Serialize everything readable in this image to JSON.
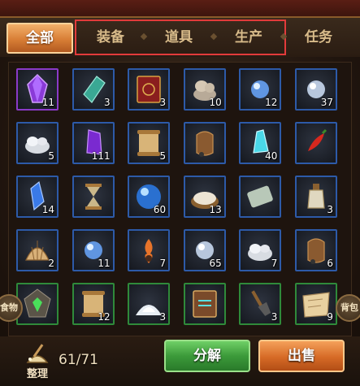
{
  "tabs": {
    "all": "全部",
    "items": [
      "装备",
      "道具",
      "生产",
      "任务"
    ]
  },
  "colors": {
    "tab_highlight_border": "#e23b3b",
    "slot_blue": "#2d5aa8",
    "slot_green": "#2f8a3a",
    "slot_purple": "#8a3ac8"
  },
  "inventory": [
    {
      "icon": "purple-gem-icon",
      "count": "11",
      "rarity": "purple"
    },
    {
      "icon": "green-crystal-icon",
      "count": "3",
      "rarity": "blue"
    },
    {
      "icon": "red-book-icon",
      "count": "3",
      "rarity": "blue"
    },
    {
      "icon": "stone-pile-icon",
      "count": "10",
      "rarity": "blue"
    },
    {
      "icon": "blue-orb-icon",
      "count": "12",
      "rarity": "blue"
    },
    {
      "icon": "white-orb-icon",
      "count": "37",
      "rarity": "blue"
    },
    {
      "icon": "silver-ore-icon",
      "count": "5",
      "rarity": "blue"
    },
    {
      "icon": "purple-crystal-icon",
      "count": "111",
      "rarity": "blue"
    },
    {
      "icon": "scroll-icon",
      "count": "5",
      "rarity": "blue"
    },
    {
      "icon": "leather-pouch-icon",
      "count": "",
      "rarity": "blue"
    },
    {
      "icon": "cyan-crystal-icon",
      "count": "40",
      "rarity": "blue"
    },
    {
      "icon": "red-pepper-icon",
      "count": "",
      "rarity": "blue"
    },
    {
      "icon": "blue-crystal-icon",
      "count": "14",
      "rarity": "blue"
    },
    {
      "icon": "hourglass-icon",
      "count": "",
      "rarity": "blue"
    },
    {
      "icon": "blue-sphere-icon",
      "count": "60",
      "rarity": "blue"
    },
    {
      "icon": "flour-bowl-icon",
      "count": "13",
      "rarity": "blue"
    },
    {
      "icon": "cloth-roll-icon",
      "count": "",
      "rarity": "blue"
    },
    {
      "icon": "potion-bottle-icon",
      "count": "3",
      "rarity": "blue"
    },
    {
      "icon": "shell-icon",
      "count": "2",
      "rarity": "blue"
    },
    {
      "icon": "blue-orb-icon",
      "count": "11",
      "rarity": "blue"
    },
    {
      "icon": "flame-ring-icon",
      "count": "7",
      "rarity": "blue"
    },
    {
      "icon": "white-orb-icon",
      "count": "65",
      "rarity": "blue"
    },
    {
      "icon": "silver-ore-icon",
      "count": "7",
      "rarity": "blue"
    },
    {
      "icon": "leather-pouch-icon",
      "count": "6",
      "rarity": "blue"
    },
    {
      "icon": "green-rune-icon",
      "count": "",
      "rarity": "green"
    },
    {
      "icon": "scroll-icon",
      "count": "12",
      "rarity": "green"
    },
    {
      "icon": "salt-pile-icon",
      "count": "3",
      "rarity": "green"
    },
    {
      "icon": "tome-icon",
      "count": "",
      "rarity": "green"
    },
    {
      "icon": "shovel-icon",
      "count": "3",
      "rarity": "green"
    },
    {
      "icon": "map-icon",
      "count": "9",
      "rarity": "green"
    }
  ],
  "side": {
    "left": "食物",
    "right": "背包"
  },
  "footer": {
    "sort_label": "整理",
    "capacity": "61/71",
    "decompose_label": "分解",
    "sell_label": "出售"
  }
}
